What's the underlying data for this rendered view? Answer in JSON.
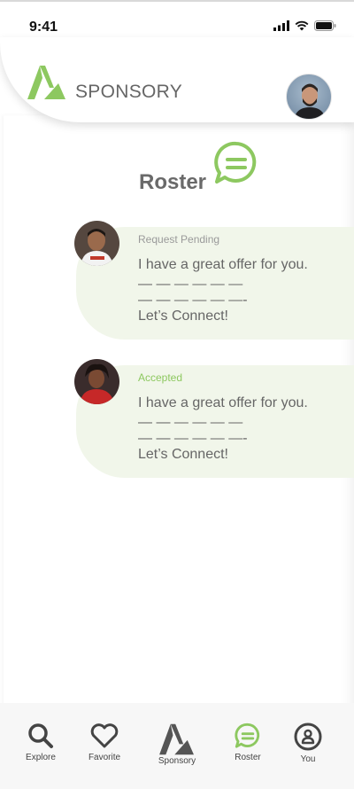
{
  "status_bar": {
    "time": "9:41"
  },
  "header": {
    "brand": "SPONSORY"
  },
  "page": {
    "title": "Roster"
  },
  "roster": [
    {
      "status": "Request Pending",
      "status_type": "pending",
      "message": "I have a great offer for you.",
      "line2": "— — — — — —",
      "line3": "— — — — — —-",
      "cta": "Let’s Connect!"
    },
    {
      "status": "Accepted",
      "status_type": "accepted",
      "message": "I have a great offer for you.",
      "line2": "— — — — — —",
      "line3": "— — — — — —-",
      "cta": "Let’s Connect!"
    }
  ],
  "nav": [
    {
      "label": "Explore",
      "icon": "search-icon"
    },
    {
      "label": "Favorite",
      "icon": "heart-icon"
    },
    {
      "label": "Sponsory",
      "icon": "sponsory-logo-icon"
    },
    {
      "label": "Roster",
      "icon": "chat-icon",
      "active": true
    },
    {
      "label": "You",
      "icon": "profile-icon"
    }
  ],
  "colors": {
    "accent": "#8dc860",
    "card_bg": "#f1f6ea",
    "text": "#6f6f6f"
  }
}
